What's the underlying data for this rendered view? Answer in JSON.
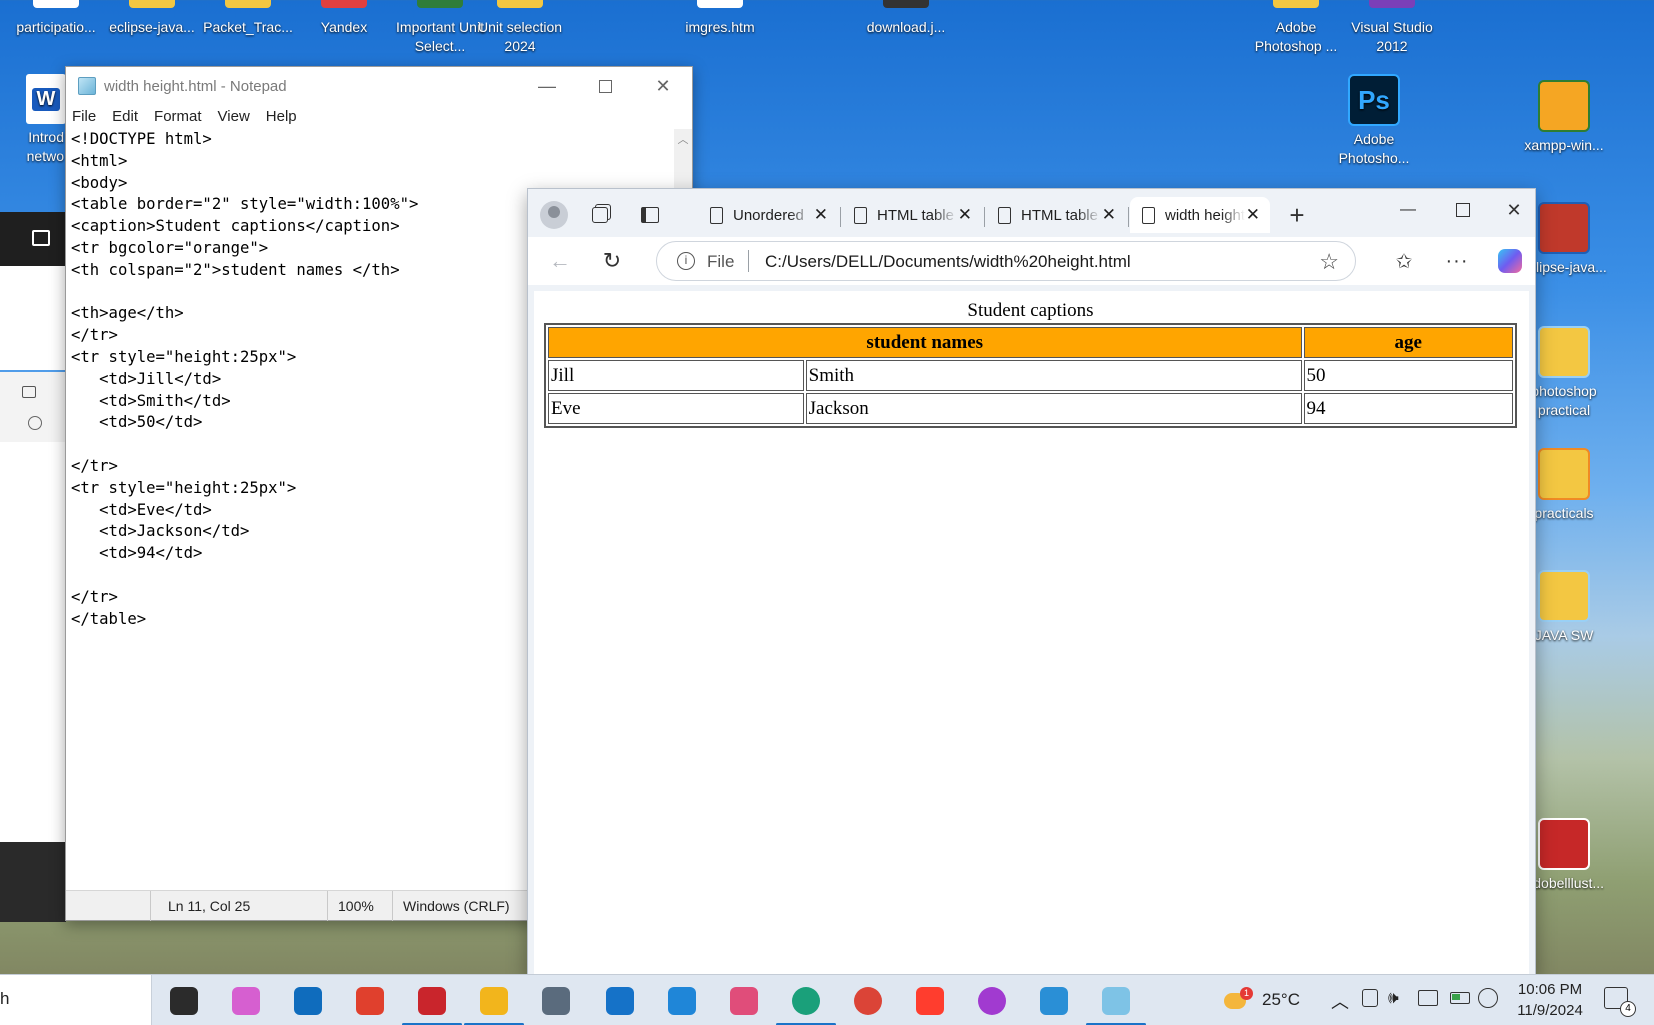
{
  "desktop": {
    "top_row": [
      {
        "label": "participatio...",
        "color": "#ffffff"
      },
      {
        "label": "eclipse-java...",
        "color": "#f3c742"
      },
      {
        "label": "Packet_Trac...",
        "color": "#f3c742"
      },
      {
        "label": "Yandex",
        "color": "#e04040"
      },
      {
        "label": "Important Unit Select...",
        "color": "#2f7d3a"
      },
      {
        "label": "Unit selection 2024",
        "color": "#f3c742"
      },
      {
        "label": "imgres.htm",
        "color": "#ffffff"
      },
      {
        "label": "download.j...",
        "color": "#333333"
      },
      {
        "label": "Adobe Photoshop ...",
        "color": "#f3c742"
      },
      {
        "label": "Visual Studio 2012",
        "color": "#7b3fb8"
      }
    ],
    "left_partial": {
      "label": "Introd netwo",
      "badge": "W"
    },
    "right_icons": [
      {
        "label": "Adobe Photosho...",
        "badge": "Ps",
        "color": "#001e36",
        "accent": "#31a8ff"
      },
      {
        "label": "xampp-win...",
        "badge": "",
        "color": "#f5a623",
        "accent": "#2e7d32"
      },
      {
        "label": "eclipse-java...",
        "badge": "",
        "color": "#c0392b",
        "accent": "#1f5fb5"
      },
      {
        "label": "photoshop practical",
        "badge": "",
        "color": "#f3c742",
        "accent": "#9ad0f5"
      },
      {
        "label": "practicals",
        "badge": "",
        "color": "#f3c742",
        "accent": "#f08a24"
      },
      {
        "label": "JAVA SW",
        "badge": "",
        "color": "#f3c742",
        "accent": "#9ad0f5"
      },
      {
        "label": "Adobelllust...",
        "badge": "",
        "color": "#c62828",
        "accent": "#ffffff"
      }
    ]
  },
  "notepad": {
    "title": "width height.html - Notepad",
    "menu": [
      "File",
      "Edit",
      "Format",
      "View",
      "Help"
    ],
    "content": "<!DOCTYPE html>\n<html>\n<body>\n<table border=\"2\" style=\"width:100%\">\n<caption>Student captions</caption>\n<tr bgcolor=\"orange\">\n<th colspan=\"2\">student names </th>\n\n<th>age</th>\n</tr>\n<tr style=\"height:25px\">\n   <td>Jill</td>\n   <td>Smith</td>\n   <td>50</td>\n\n</tr>\n<tr style=\"height:25px\">\n   <td>Eve</td>\n   <td>Jackson</td>\n   <td>94</td>\n\n</tr>\n</table>",
    "status": {
      "position": "Ln 11, Col 25",
      "zoom": "100%",
      "line_endings": "Windows (CRLF)"
    }
  },
  "browser": {
    "tabs": [
      {
        "label": "Unordered"
      },
      {
        "label": "HTML table"
      },
      {
        "label": "HTML table"
      },
      {
        "label": "width height"
      }
    ],
    "address": {
      "scheme_label": "File",
      "url": "C:/Users/DELL/Documents/width%20height.html"
    },
    "page": {
      "caption": "Student captions",
      "header_bg": "#ffa500",
      "headers": [
        "student names",
        "age"
      ],
      "rows": [
        [
          "Jill",
          "Smith",
          "50"
        ],
        [
          "Eve",
          "Jackson",
          "94"
        ]
      ]
    }
  },
  "taskbar": {
    "search_text": "h",
    "apps": [
      {
        "name": "task-view",
        "color": "#2b2b2b"
      },
      {
        "name": "copilot",
        "color": "#d65fd0"
      },
      {
        "name": "outlook",
        "color": "#0f6cbd"
      },
      {
        "name": "app-red",
        "color": "#e0402d"
      },
      {
        "name": "ecu-website",
        "color": "#c9252c"
      },
      {
        "name": "file-explorer",
        "color": "#f2b51c"
      },
      {
        "name": "calculator",
        "color": "#5a6b7d"
      },
      {
        "name": "mail",
        "color": "#1572c8"
      },
      {
        "name": "azure",
        "color": "#1f86d8"
      },
      {
        "name": "app-pink",
        "color": "#e04d7a"
      },
      {
        "name": "edge",
        "color": "#1aa07a"
      },
      {
        "name": "chrome",
        "color": "#db4437"
      },
      {
        "name": "yandex",
        "color": "#ff3d2e"
      },
      {
        "name": "app-purple",
        "color": "#a13ad0"
      },
      {
        "name": "photos",
        "color": "#2a8fd6"
      },
      {
        "name": "notepad",
        "color": "#7ec3e6"
      }
    ],
    "weather": "25°C",
    "weather_badge": "1",
    "time": "10:06 PM",
    "date": "11/9/2024",
    "notification_count": "4"
  }
}
